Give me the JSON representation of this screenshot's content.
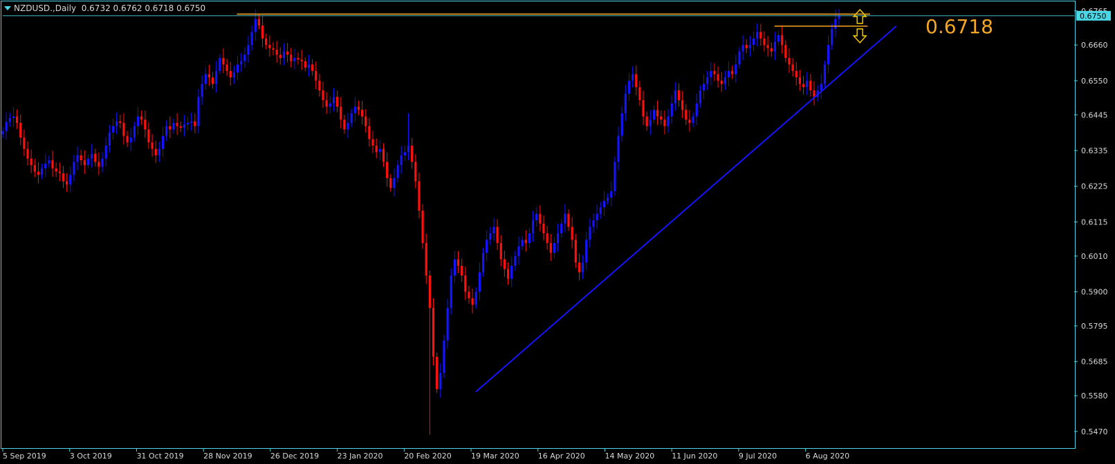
{
  "chart_data": {
    "type": "candlestick",
    "symbol_label": "NZDUSD.,Daily",
    "ohlc_label": "0.6732 0.6762 0.6718 0.6750",
    "ylim": [
      0.5425,
      0.679
    ],
    "y_ticks": [
      "0.6765",
      "0.6660",
      "0.6550",
      "0.6445",
      "0.6335",
      "0.6225",
      "0.6115",
      "0.6010",
      "0.5900",
      "0.5795",
      "0.5685",
      "0.5580",
      "0.5470"
    ],
    "x_ticks": [
      "5 Sep 2019",
      "3 Oct 2019",
      "31 Oct 2019",
      "28 Nov 2019",
      "26 Dec 2019",
      "23 Jan 2020",
      "20 Feb 2020",
      "19 Mar 2020",
      "16 Apr 2020",
      "14 May 2020",
      "11 Jun 2020",
      "9 Jul 2020",
      "6 Aug 2020"
    ],
    "current_price": "0.6750",
    "annotation_price": "0.6718",
    "levels": [
      {
        "name": "resistance",
        "value": 0.6755,
        "from": "12 Dec 2019",
        "to": "2 Sep 2020"
      },
      {
        "name": "support",
        "value": 0.6718,
        "from": "24 Jul 2020",
        "to": "1 Sep 2020"
      }
    ],
    "trendline": {
      "from": {
        "date": "21 Mar 2020",
        "price": 0.5592
      },
      "to": {
        "date": "13 Sep 2020",
        "price": 0.6718
      }
    },
    "closes": [
      0.6395,
      0.6423,
      0.6435,
      0.644,
      0.642,
      0.6375,
      0.634,
      0.631,
      0.629,
      0.627,
      0.626,
      0.628,
      0.6295,
      0.6305,
      0.628,
      0.627,
      0.6265,
      0.624,
      0.623,
      0.626,
      0.63,
      0.632,
      0.6305,
      0.629,
      0.631,
      0.6325,
      0.63,
      0.6285,
      0.631,
      0.635,
      0.639,
      0.641,
      0.6425,
      0.642,
      0.638,
      0.636,
      0.6375,
      0.641,
      0.644,
      0.643,
      0.64,
      0.636,
      0.634,
      0.632,
      0.634,
      0.638,
      0.641,
      0.64,
      0.642,
      0.641,
      0.6405,
      0.6415,
      0.642,
      0.6425,
      0.641,
      0.65,
      0.654,
      0.657,
      0.656,
      0.654,
      0.658,
      0.662,
      0.66,
      0.658,
      0.656,
      0.6575,
      0.66,
      0.661,
      0.663,
      0.666,
      0.67,
      0.674,
      0.672,
      0.668,
      0.666,
      0.665,
      0.6645,
      0.663,
      0.662,
      0.664,
      0.663,
      0.661,
      0.662,
      0.6615,
      0.661,
      0.659,
      0.66,
      0.658,
      0.655,
      0.652,
      0.649,
      0.647,
      0.648,
      0.65,
      0.647,
      0.643,
      0.64,
      0.642,
      0.645,
      0.647,
      0.646,
      0.644,
      0.641,
      0.637,
      0.635,
      0.633,
      0.634,
      0.63,
      0.625,
      0.622,
      0.625,
      0.629,
      0.632,
      0.633,
      0.635,
      0.63,
      0.624,
      0.615,
      0.605,
      0.595,
      0.585,
      0.57,
      0.56,
      0.565,
      0.575,
      0.585,
      0.595,
      0.6,
      0.598,
      0.595,
      0.59,
      0.588,
      0.586,
      0.59,
      0.596,
      0.602,
      0.606,
      0.608,
      0.61,
      0.605,
      0.6,
      0.597,
      0.594,
      0.598,
      0.601,
      0.604,
      0.606,
      0.605,
      0.608,
      0.612,
      0.614,
      0.611,
      0.608,
      0.605,
      0.602,
      0.605,
      0.608,
      0.611,
      0.614,
      0.61,
      0.606,
      0.599,
      0.596,
      0.599,
      0.606,
      0.61,
      0.612,
      0.614,
      0.616,
      0.618,
      0.619,
      0.621,
      0.63,
      0.638,
      0.645,
      0.651,
      0.655,
      0.657,
      0.653,
      0.649,
      0.644,
      0.641,
      0.643,
      0.646,
      0.644,
      0.643,
      0.641,
      0.644,
      0.648,
      0.652,
      0.649,
      0.646,
      0.643,
      0.642,
      0.644,
      0.648,
      0.652,
      0.654,
      0.656,
      0.658,
      0.657,
      0.655,
      0.654,
      0.656,
      0.658,
      0.657,
      0.66,
      0.664,
      0.666,
      0.665,
      0.666,
      0.668,
      0.67,
      0.668,
      0.666,
      0.665,
      0.664,
      0.667,
      0.669,
      0.666,
      0.662,
      0.66,
      0.658,
      0.656,
      0.654,
      0.653,
      0.655,
      0.652,
      0.65,
      0.652,
      0.654,
      0.66,
      0.666,
      0.671,
      0.674,
      0.675
    ]
  }
}
